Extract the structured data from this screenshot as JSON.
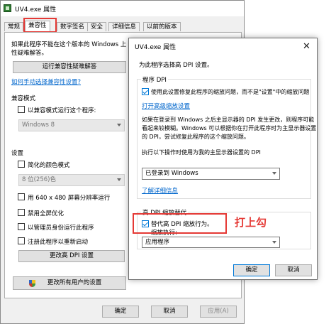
{
  "bg_window": {
    "title": "UV4.exe 属性",
    "tabs": [
      "常规",
      "兼容性",
      "数字签名",
      "安全",
      "详细信息",
      "以前的版本"
    ],
    "intro_line1": "如果此程序不能在这个版本的 Windows 上",
    "intro_line2": "性疑难解答。",
    "troubleshoot_button": "运行兼容性疑难解答",
    "manual_link": "如何手动选择兼容性设置?",
    "compat_mode_label": "兼容模式",
    "compat_mode_checkbox": "以兼容模式运行这个程序:",
    "compat_mode_select": "Windows 8",
    "settings_label": "设置",
    "reduced_color": "简化的颜色模式",
    "color_select": "8 位(256)色",
    "res_640": "用 640 x 480 屏幕分辨率运行",
    "disable_fullscreen": "禁用全屏优化",
    "run_as_admin": "以管理员身份运行此程序",
    "register_restart": "注册此程序以重新启动",
    "change_dpi_button": "更改高 DPI 设置",
    "all_users_button": "更改所有用户的设置",
    "ok": "确定",
    "cancel": "取消",
    "apply": "应用(A)"
  },
  "fg_window": {
    "title": "UV4.exe 属性",
    "subtitle": "为此程序选择高 DPI 设置。",
    "program_dpi_label": "程序 DPI",
    "program_dpi_checkbox": "使用此设置修复此程序的缩放问题，而不是\"设置\"中的缩放问题",
    "open_advanced_link": "打开高级缩放设置",
    "desc_line1": "如果在登录到 Windows 之后主显示器的 DPI 发生更改，则程序可能",
    "desc_line2": "看起来较模糊。Windows 可以根据你在打开此程序时为主显示器设置",
    "desc_line3": "的 DPI，尝试修复此程序的这个缩放问题。",
    "dpi_select_label": "执行以下操作时使用为我的主显示器设置的 DPI",
    "dpi_select_value": "已登录到 Windows",
    "learn_more_link": "了解详细信息",
    "override_label": "高 DPI 缩放替代",
    "override_checkbox": "替代高 DPI 缩放行为。",
    "scaling_by": "缩放执行:",
    "scaling_select": "应用程序",
    "ok": "确定",
    "cancel": "取消"
  },
  "annotation": "打上勾",
  "colors": {
    "highlight": "#e53935",
    "link": "#0066cc",
    "accent": "#0078d7"
  }
}
